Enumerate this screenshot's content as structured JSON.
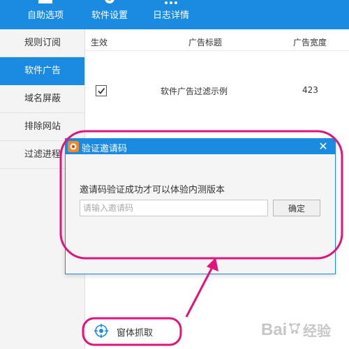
{
  "toolbar": {
    "items": [
      {
        "label": "自助选项",
        "icon": "box-icon"
      },
      {
        "label": "软件设置",
        "icon": "gear-icon"
      },
      {
        "label": "日志详情",
        "icon": "dots-icon"
      }
    ]
  },
  "sidebar": {
    "items": [
      {
        "label": "规则订阅",
        "active": false
      },
      {
        "label": "软件广告",
        "active": true
      },
      {
        "label": "域名屏蔽",
        "active": false
      },
      {
        "label": "排除网站",
        "active": false
      },
      {
        "label": "过滤进程",
        "active": false
      }
    ]
  },
  "table": {
    "headers": [
      "生效",
      "广告标题",
      "广告宽度"
    ],
    "rows": [
      {
        "enabled": true,
        "title": "软件广告过滤示例",
        "width": "423"
      }
    ]
  },
  "dialog": {
    "title": "验证邀请码",
    "message": "邀请码验证成功才可以体验内测版本",
    "input_placeholder": "请输入邀请码",
    "input_value": "",
    "confirm_label": "确定",
    "close_icon": "close-icon"
  },
  "capture": {
    "label": "窗体抓取",
    "icon": "crosshair-icon"
  },
  "watermark": {
    "text": "Bai经验"
  },
  "colors": {
    "accent": "#1a8be0",
    "annotation": "#e0147a"
  }
}
